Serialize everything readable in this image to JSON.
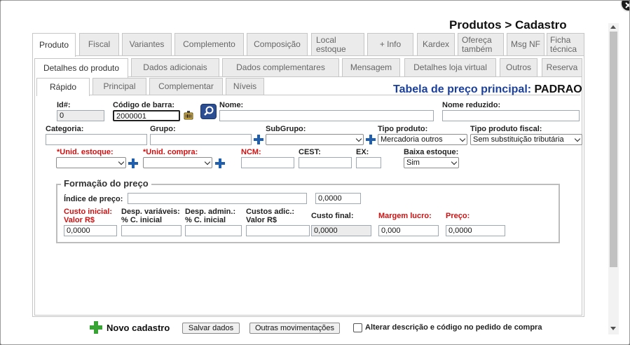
{
  "window": {
    "title": "Produtos > Cadastro"
  },
  "tabs_level1": [
    {
      "label": "Produto"
    },
    {
      "label": "Fiscal"
    },
    {
      "label": "Variantes"
    },
    {
      "label": "Complemento"
    },
    {
      "label": "Composição"
    },
    {
      "label": "Local estoque"
    },
    {
      "label": "+ Info"
    },
    {
      "label": "Kardex"
    },
    {
      "label": "Ofereça também"
    },
    {
      "label": "Msg NF"
    },
    {
      "label": "Ficha técnica"
    }
  ],
  "tabs_level2": [
    {
      "label": "Detalhes do produto"
    },
    {
      "label": "Dados adicionais"
    },
    {
      "label": "Dados complementares"
    },
    {
      "label": "Mensagem"
    },
    {
      "label": "Detalhes loja virtual"
    },
    {
      "label": "Outros"
    },
    {
      "label": "Reserva"
    }
  ],
  "tabs_level3": [
    {
      "label": "Rápido"
    },
    {
      "label": "Principal"
    },
    {
      "label": "Complementar"
    },
    {
      "label": "Níveis"
    }
  ],
  "price_table": {
    "label": "Tabela de preço principal:",
    "value": "PADRAO"
  },
  "form": {
    "id_label": "Id#:",
    "id_value": "0",
    "barcode_label": "Código de barra:",
    "barcode_value": "2000001",
    "name_label": "Nome:",
    "name_value": "",
    "short_name_label": "Nome reduzido:",
    "short_name_value": "",
    "category_label": "Categoria:",
    "group_label": "Grupo:",
    "subgroup_label": "SubGrupo:",
    "product_type_label": "Tipo produto:",
    "product_type_value": "Mercadoria outros",
    "fiscal_type_label": "Tipo produto fiscal:",
    "fiscal_type_value": "Sem substituição tributária",
    "stock_unit_label": "*Unid. estoque:",
    "purchase_unit_label": "*Unid. compra:",
    "ncm_label": "NCM:",
    "cest_label": "CEST:",
    "ex_label": "EX:",
    "stock_writeoff_label": "Baixa estoque:",
    "stock_writeoff_value": "Sim"
  },
  "pricing": {
    "legend": "Formação do preço",
    "index_label": "Índice de preço:",
    "index_text": "",
    "index_value": "0,0000",
    "initial_cost_label_1": "Custo inicial:",
    "initial_cost_label_2": "Valor R$",
    "initial_cost_value": "0,0000",
    "var_exp_label_1": "Desp. variáveis:",
    "var_exp_label_2": "% C. inicial",
    "var_exp_value": "",
    "admin_exp_label_1": "Desp. admin.:",
    "admin_exp_label_2": "% C. inicial",
    "admin_exp_value": "",
    "add_cost_label_1": "Custos adic.:",
    "add_cost_label_2": "Valor R$",
    "add_cost_value": "",
    "final_cost_label": "Custo final:",
    "final_cost_value": "0,0000",
    "margin_label": "Margem lucro:",
    "margin_value": "0,000",
    "price_label": "Preço:",
    "price_value": "0,0000"
  },
  "footer": {
    "new_label": "Novo cadastro",
    "save_label": "Salvar dados",
    "other_label": "Outras movimentações",
    "checkbox_label": "Alterar descrição e código no pedido de compra",
    "checkbox_checked": false
  },
  "colors": {
    "accent_blue": "#1f5fae",
    "required_red": "#d01010",
    "add_green": "#3aa335"
  },
  "icons": [
    "close-icon",
    "search-icon",
    "barcode-scanner-icon",
    "add-plus-icon",
    "new-record-plus-icon"
  ]
}
